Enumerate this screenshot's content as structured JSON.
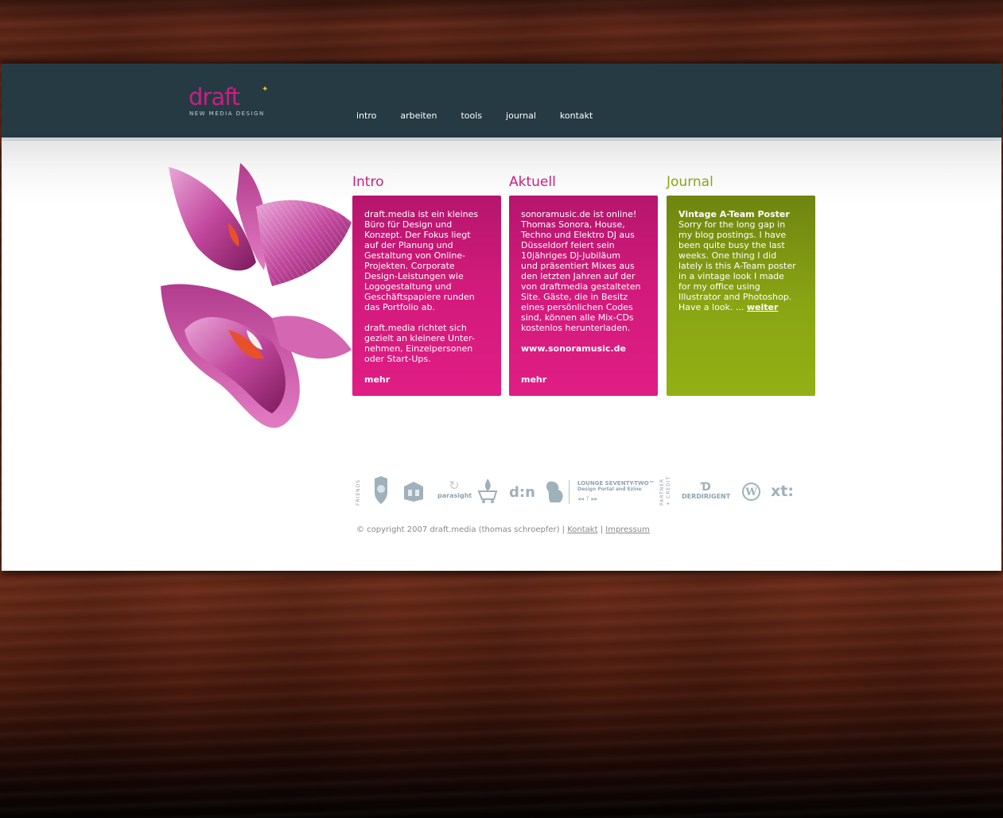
{
  "brand": {
    "logo_text": "draft",
    "logo_sub": "NEW MEDIA DESIGN",
    "colors": {
      "pink": "#cc1e82",
      "green": "#8aa514",
      "header": "#263a44"
    }
  },
  "nav": {
    "items": [
      {
        "label": "intro"
      },
      {
        "label": "arbeiten"
      },
      {
        "label": "tools"
      },
      {
        "label": "journal"
      },
      {
        "label": "kontakt"
      }
    ]
  },
  "columns": {
    "intro": {
      "title": "Intro",
      "p1": "draft.media ist ein kleines\nBüro für Design und\nKonzept. Der Fokus liegt\nauf der Planung und\nGestaltung von Online-\nProjekten. Corporate\nDesign-Leistungen wie\nLogogestaltung und\nGeschäftspapiere runden\ndas Portfolio ab.",
      "p2": "draft.media richtet sich\ngezielt an kleinere Unter-\nnehmen, Einzelpersonen\noder Start-Ups.",
      "more": "mehr"
    },
    "aktuell": {
      "title": "Aktuell",
      "p1": "sonoramusic.de ist online!\nThomas Sonora, House,\nTechno und Elektro DJ aus\nDüsseldorf feiert sein\n10jähriges DJ-Jubiläum\nund präsentiert Mixes aus\nden letzten Jahren auf der\nvon draftmedia gestalteten\nSite. Gäste, die in Besitz\neines persönlichen Codes\nsind, können alle Mix-CDs\nkostenlos herunterladen.",
      "link": "www.sonoramusic.de",
      "more": "mehr"
    },
    "journal": {
      "title": "Journal",
      "post_title": "Vintage A-Team Poster",
      "body": "Sorry for the long gap in\nmy blog postings. I have\nbeen quite busy the last\nweeks. One thing I did\nlately is this A-Team poster\nin a vintage look I made\nfor my office using\nIllustrator and Photoshop.\nHave a look. ... ",
      "more": "weiter"
    }
  },
  "strip": {
    "friends_label": "FRIENDS",
    "partner_label": "PARTNER\n+ CREDIT",
    "parasight": "parasight",
    "dn": "d:n",
    "lounge_title": "LOUNGE SEVENTY-TWO™",
    "lounge_sub": "Design Portal and Ezine",
    "lounge_controls": "◂◂   ?   ▸▸",
    "derdirigent": "DERDIRIGENT",
    "xt": "xt:"
  },
  "footer": {
    "copyright": "© copyright 2007 draft.media (thomas schroepfer) | ",
    "sep": " | ",
    "kontakt": "Kontakt",
    "impressum": "Impressum"
  }
}
